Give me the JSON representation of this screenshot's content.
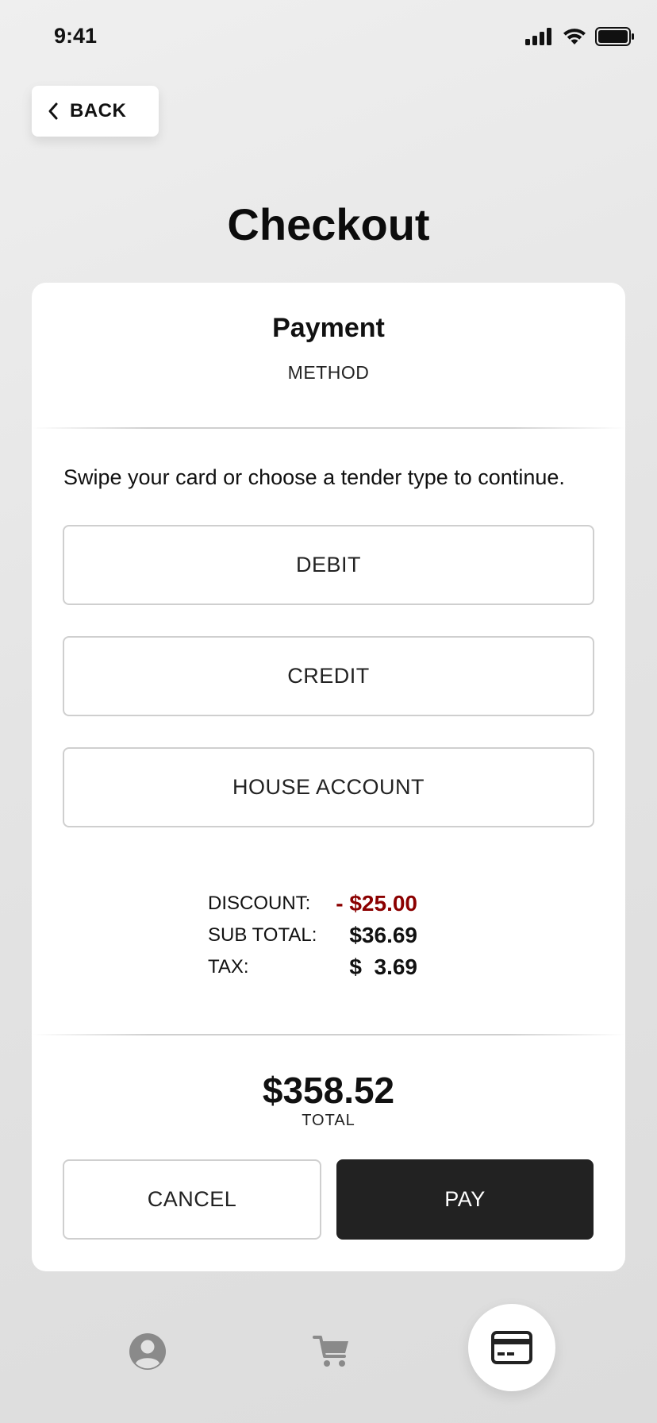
{
  "status_bar": {
    "time": "9:41"
  },
  "back_button": {
    "label": "BACK"
  },
  "page": {
    "title": "Checkout"
  },
  "card": {
    "title": "Payment",
    "subtitle": "METHOD",
    "instructions": "Swipe your card or choose a tender type to continue.",
    "tenders": [
      {
        "label": "DEBIT"
      },
      {
        "label": "CREDIT"
      },
      {
        "label": "HOUSE ACCOUNT"
      }
    ],
    "summary": {
      "discount_label": "DISCOUNT:",
      "discount_value": "- $25.00",
      "subtotal_label": "SUB TOTAL:",
      "subtotal_value": "$36.69",
      "tax_label": "TAX:",
      "tax_value": "$  3.69"
    },
    "total": {
      "amount": "$358.52",
      "label": "TOTAL"
    },
    "actions": {
      "cancel_label": "CANCEL",
      "pay_label": "PAY"
    }
  },
  "bottom_nav": {
    "items": [
      {
        "icon": "profile-icon"
      },
      {
        "icon": "cart-icon"
      },
      {
        "icon": "credit-card-icon",
        "active": true
      }
    ]
  },
  "colors": {
    "discount": "#8b0000",
    "pay_button": "#222222",
    "card_background": "#ffffff",
    "nav_icon": "#8a8a8a"
  }
}
